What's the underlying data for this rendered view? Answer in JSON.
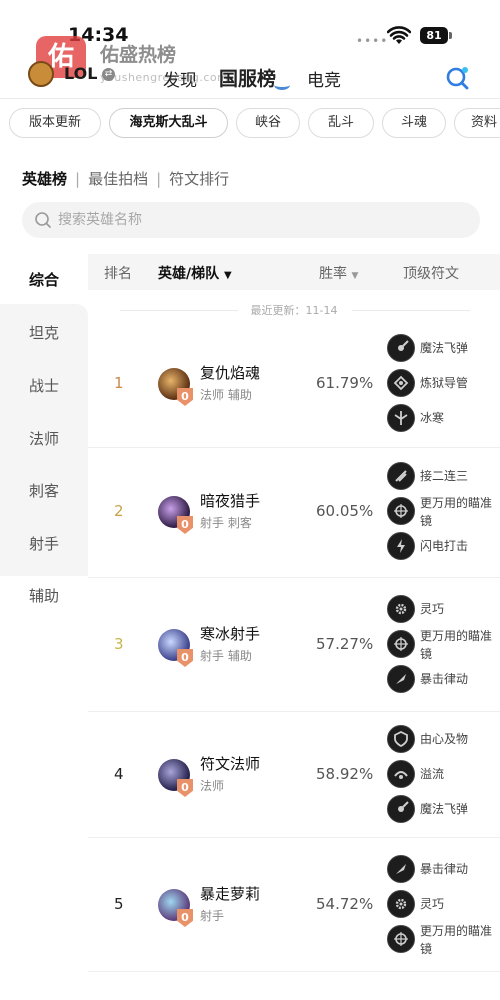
{
  "status_bar": {
    "time": "14:34",
    "battery": "81"
  },
  "watermark": {
    "badge": "佑",
    "title": "佑盛热榜",
    "subtitle": "youshengrebang.com"
  },
  "header": {
    "game": "LOL",
    "tabs": [
      {
        "label": "发现"
      },
      {
        "label": "国服榜"
      },
      {
        "label": "电竞"
      }
    ],
    "active_tab": "国服榜"
  },
  "modes": [
    {
      "label": "版本更新"
    },
    {
      "label": "海克斯大乱斗"
    },
    {
      "label": "峡谷"
    },
    {
      "label": "乱斗"
    },
    {
      "label": "斗魂"
    },
    {
      "label": "资料"
    }
  ],
  "subtabs": [
    {
      "label": "英雄榜"
    },
    {
      "label": "最佳拍档"
    },
    {
      "label": "符文排行"
    }
  ],
  "search": {
    "placeholder": "搜索英雄名称"
  },
  "categories": [
    {
      "label": "综合"
    },
    {
      "label": "坦克"
    },
    {
      "label": "战士"
    },
    {
      "label": "法师"
    },
    {
      "label": "刺客"
    },
    {
      "label": "射手"
    },
    {
      "label": "辅助"
    }
  ],
  "table": {
    "headers": {
      "rank": "排名",
      "hero": "英雄/梯队",
      "winrate": "胜率",
      "runes": "顶级符文"
    },
    "last_updated": "最近更新：11-14",
    "rows": [
      {
        "rank": "1",
        "tier": "0",
        "name": "复仇焰魂",
        "roles": "法师 辅助",
        "winrate": "61.79%",
        "runes": [
          {
            "name": "魔法飞弹",
            "icon": "arcane-comet-icon"
          },
          {
            "name": "炼狱导管",
            "icon": "inferno-conduit-icon"
          },
          {
            "name": "冰寒",
            "icon": "glacial-icon"
          }
        ]
      },
      {
        "rank": "2",
        "tier": "0",
        "name": "暗夜猎手",
        "roles": "射手 刺客",
        "winrate": "60.05%",
        "runes": [
          {
            "name": "接二连三",
            "icon": "one-two-icon"
          },
          {
            "name": "更万用的瞄准镜",
            "icon": "scope-icon"
          },
          {
            "name": "闪电打击",
            "icon": "lightning-icon"
          }
        ]
      },
      {
        "rank": "3",
        "tier": "0",
        "name": "寒冰射手",
        "roles": "射手 辅助",
        "winrate": "57.27%",
        "runes": [
          {
            "name": "灵巧",
            "icon": "gear-icon"
          },
          {
            "name": "更万用的瞄准镜",
            "icon": "scope-icon"
          },
          {
            "name": "暴击律动",
            "icon": "crit-icon"
          }
        ]
      },
      {
        "rank": "4",
        "tier": "0",
        "name": "符文法师",
        "roles": "法师",
        "winrate": "58.92%",
        "runes": [
          {
            "name": "由心及物",
            "icon": "shield-icon"
          },
          {
            "name": "溢流",
            "icon": "overflow-icon"
          },
          {
            "name": "魔法飞弹",
            "icon": "arcane-comet-icon"
          }
        ]
      },
      {
        "rank": "5",
        "tier": "0",
        "name": "暴走萝莉",
        "roles": "射手",
        "winrate": "54.72%",
        "runes": [
          {
            "name": "暴击律动",
            "icon": "crit-icon"
          },
          {
            "name": "灵巧",
            "icon": "gear-icon"
          },
          {
            "name": "更万用的瞄准镜",
            "icon": "scope-icon"
          }
        ]
      }
    ]
  },
  "colors": {
    "rank_1": "#c98a4a",
    "rank_2": "#c9a24a",
    "rank_3": "#c9b54a",
    "rank_default": "#222222",
    "accent": "#4a89d8",
    "tier_shield": "#e9926a"
  }
}
